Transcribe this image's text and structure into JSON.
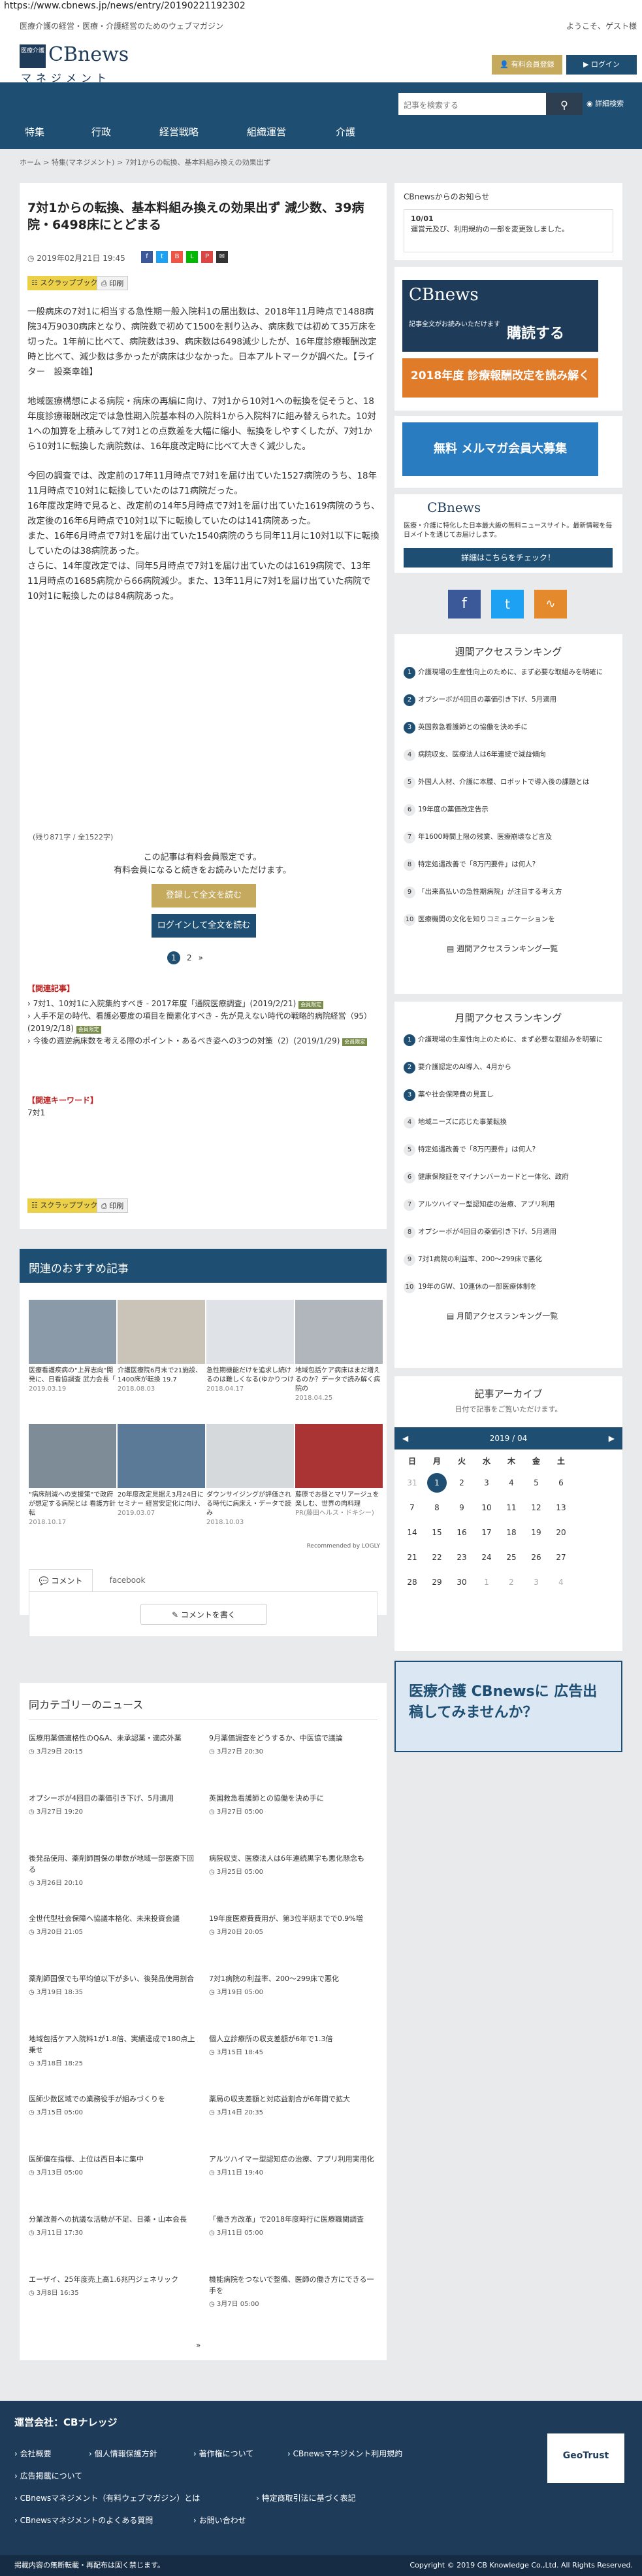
{
  "url": "https://www.cbnews.jp/news/entry/20190221192302",
  "top": {
    "tagline": "医療介護の経営・医療・介護経営のためのウェブマガジン",
    "welcome": "ようこそ、ゲスト様"
  },
  "logo": {
    "badge": "医療介護",
    "name": "CBnews",
    "sub": "マネジメント"
  },
  "header_buttons": {
    "register": "有料会員登録",
    "login": "ログイン"
  },
  "nav": {
    "items": [
      "特集",
      "行政",
      "経営戦略",
      "組織運営",
      "介護"
    ]
  },
  "search": {
    "placeholder": "記事を検索する",
    "detail": "詳細検索"
  },
  "breadcrumb": "ホーム > 特集(マネジメント) > 7対1からの転換、基本料組み換えの効果出ず",
  "article": {
    "title": "7対1からの転換、基本料組み換えの効果出ず 減少数、39病院・6498床にとどまる",
    "date": "2019年02月21日 19:45",
    "scrap": "スクラップブック",
    "print": "印刷",
    "paragraphs": [
      "一般病床の7対1に相当する急性期一般入院料1の届出数は、2018年11月時点で1488病院34万9030病床となり、病院数で初めて1500を割り込み、病床数では初めて35万床を切った。1年前に比べて、病院数は39、病床数は6498減少したが、16年度診療報酬改定時と比べて、減少数は多かったが病床は少なかった。日本アルトマークが調べた。【ライター　設楽幸雄】",
      "地域医療構想による病院・病床の再編に向け、7対1から10対1への転換を促そうと、18年度診療報酬改定では急性期入院基本料の入院料1から入院料7に組み替えられた。10対1への加算を上積みして7対1との点数差を大幅に縮小、転換をしやすくしたが、7対1から10対1に転換した病院数は、16年度改定時に比べて大きく減少した。",
      "今回の調査では、改定前の17年11月時点で7対1を届け出ていた1527病院のうち、18年11月時点で10対1に転換していたのは71病院だった。",
      "16年度改定時で見ると、改定前の14年5月時点で7対1を届け出ていた1619病院のうち、改定後の16年6月時点で10対1以下に転換していたのは141病院あった。",
      "また、16年6月時点で7対1を届け出ていた1540病院のうち同年11月に10対1以下に転換していたのは38病院あった。",
      "さらに、14年度改定では、同年5月時点で7対1を届け出ていたのは1619病院で、13年11月時点の1685病院から66病院減少。また、13年11月に7対1を届け出ていた病院で10対1に転換したのは84病院あった。"
    ],
    "charcount": "(残り871字 / 全1522字)",
    "members_only": [
      "この記事は有料会員限定です。",
      "有料会員になると続きをお読みいただけます。"
    ],
    "register_btn": "登録して全文を読む",
    "login_btn": "ログインして全文を読む",
    "pages": [
      "1",
      "2",
      "»"
    ]
  },
  "related": {
    "title": "【関連記事】",
    "items": [
      "7対1、10対1に入院集約すべき - 2017年度「通院医療調査」(2019/2/21)",
      "人手不足の時代、看護必要度の項目を簡素化すべき - 先が見えない時代の戦略的病院経営（95）(2019/2/18)",
      "今後の週逆病床数を考える際のポイント・あるべき姿への3つの対策（2）(2019/1/29)"
    ],
    "badge": "会員限定"
  },
  "keywords": {
    "title": "【関連キーワード】",
    "items": [
      "7対1"
    ]
  },
  "sidebar": {
    "notice_title": "CBnewsからのお知らせ",
    "notice_date": "10/01",
    "notice_text": "運営元及び、利用規約の一部を変更致しました。",
    "ad1_text": "記事全文がお読みいただけます",
    "ad1_cta": "購読する",
    "ad2_text": "2018年度 診療報酬改定を読み解く",
    "ad3_text": "無料 メルマガ会員大募集",
    "about_text": "医療・介護に特化した日本最大級の無料ニュースサイト。最新情報を毎日メイトを通じてお届けします。",
    "about_btn": "詳細はこちらをチェック！",
    "weekly_title": "週間アクセスランキング",
    "weekly": [
      "介護現場の生産性向上のために、まず必要な取組みを明確に",
      "オプシーボが4回目の薬価引き下げ、5月適用",
      "英国救急看護師との協働を決め手に",
      "病院収支、医療法人は6年連続で減益傾向",
      "外国人人材、介護に本腰、ロボットで導入後の課題とは",
      "19年度の薬価改定告示",
      "年1600時間上限の残業、医療崩壊など言及",
      "特定処遇改善で「8万円要件」は何人?",
      "「出来高払いの急性期病院」が注目する考え方",
      "医療機関の文化を知りコミュニケーションを"
    ],
    "weekly_more": "週間アクセスランキング一覧",
    "monthly_title": "月間アクセスランキング",
    "monthly": [
      "介護現場の生産性向上のために、まず必要な取組みを明確に",
      "要介護認定のAI導入、4月から",
      "薬や社会保障費の見直し",
      "地域ニーズに応じた事業転換",
      "特定処遇改善で「8万円要件」は何人?",
      "健康保険証をマイナンバーカードと一体化、政府",
      "アルツハイマー型認知症の治療、アプリ利用",
      "オプシーボが4回目の薬価引き下げ、5月適用",
      "7対1病院の利益率、200～299床で悪化",
      "19年のGW、10連休の一部医療体制を"
    ],
    "monthly_more": "月間アクセスランキング一覧",
    "archive_title": "記事アーカイブ",
    "archive_sub": "日付で記事をご覧いただけます。",
    "calendar_month": "2019 / 04",
    "weekdays": [
      "日",
      "月",
      "火",
      "水",
      "木",
      "金",
      "土"
    ],
    "weeks": [
      [
        "31",
        "1",
        "2",
        "3",
        "4",
        "5",
        "6"
      ],
      [
        "7",
        "8",
        "9",
        "10",
        "11",
        "12",
        "13"
      ],
      [
        "14",
        "15",
        "16",
        "17",
        "18",
        "19",
        "20"
      ],
      [
        "21",
        "22",
        "23",
        "24",
        "25",
        "26",
        "27"
      ],
      [
        "28",
        "29",
        "30",
        "1",
        "2",
        "3",
        "4"
      ]
    ],
    "ad_bottom": "医療介護 CBnewsに 広告出稿してみませんか？"
  },
  "reco": {
    "title": "関連のおすすめ記事",
    "row1": [
      {
        "t": "医療看護疾病の\"上昇志向\"開発に、日看協調査 武力会長「",
        "d": "2019.03.19"
      },
      {
        "t": "介護医療院6月末で21施設、1400床が転換 19.7",
        "d": "2018.08.03"
      },
      {
        "t": "急性期機能だけを追求し続けるのは難しくなる(ゆかりつけ",
        "d": "2018.04.17"
      },
      {
        "t": "地域包括ケア病床はまだ増えるのか？データで読み解く病院の",
        "d": "2018.04.25"
      }
    ],
    "row2": [
      {
        "t": "\"病床削減への支援策\"で政府が想定する病院とは 看護方針転",
        "d": "2018.10.17"
      },
      {
        "t": "20年度改定見据え3月24日にセミナー 経営安定化に向け、",
        "d": "2019.03.07"
      },
      {
        "t": "ダウンサイジングが評価される時代に病床え・データで読み",
        "d": "2018.10.03"
      },
      {
        "t": "藤原でお昼とマリアージュを楽しむ、世界の肉料理",
        "d": "PR(藤田ヘルス・ドキシー)"
      }
    ],
    "recommend_by": "Recommended by LOGLY"
  },
  "comments": {
    "tab1": "コメント",
    "tab2": "facebook",
    "write": "コメントを書く"
  },
  "catnews": {
    "title": "同カテゴリーのニュース",
    "left": [
      {
        "t": "医療用薬価適格性のQ&A、未承認薬・適応外薬",
        "d": "3月29日 20:15"
      },
      {
        "t": "オプシーボが4回目の薬価引き下げ、5月適用",
        "d": "3月27日 19:20"
      },
      {
        "t": "後発品使用、薬剤師国保の単数が地域一部医療下回る",
        "d": "3月26日 20:10"
      },
      {
        "t": "全世代型社会保障へ協議本格化、未来投資会議",
        "d": "3月20日 21:05"
      },
      {
        "t": "薬剤師国保でも平均値以下が多い、後発品使用割合",
        "d": "3月19日 18:35"
      },
      {
        "t": "地域包括ケア入院料1が1.8倍、実績達成で180点上乗せ",
        "d": "3月18日 18:25"
      },
      {
        "t": "医師少数区域での業務役手が組みづくりを",
        "d": "3月15日 05:00"
      },
      {
        "t": "医師偏在指標、上位は西日本に集中",
        "d": "3月13日 05:00"
      },
      {
        "t": "分業改善への抗議な活動が不足、日薬・山本会長",
        "d": "3月11日 17:30"
      },
      {
        "t": "エーザイ、25年度売上高1.6兆円ジェネリック",
        "d": "3月8日 16:35"
      }
    ],
    "right": [
      {
        "t": "9月薬価調査をどうするか、中医協で議論",
        "d": "3月27日 20:30"
      },
      {
        "t": "英国救急看護師との協働を決め手に",
        "d": "3月27日 05:00"
      },
      {
        "t": "病院収支、医療法人は6年連続黒字も悪化懸念も",
        "d": "3月25日 05:00"
      },
      {
        "t": "19年度医療費費用が、第3位半期までで0.9%増",
        "d": "3月20日 20:05"
      },
      {
        "t": "7対1病院の利益率、200～299床で悪化",
        "d": "3月19日 05:00"
      },
      {
        "t": "個人立診療所の収支差額が6年で1.3倍",
        "d": "3月15日 18:45"
      },
      {
        "t": "薬局の収支差額と対応益割合が6年間で拡大",
        "d": "3月14日 20:35"
      },
      {
        "t": "アルツハイマー型認知症の治療、アプリ利用実用化",
        "d": "3月11日 19:40"
      },
      {
        "t": "「働き方改革」で2018年度時行に医療職関調査",
        "d": "3月11日 05:00"
      },
      {
        "t": "機能病院をつないで整備、医師の働き方にできる一手を",
        "d": "3月7日 05:00"
      }
    ],
    "more": "»"
  },
  "footer": {
    "title": "運営会社：CBナレッジ",
    "links1": [
      "会社概要",
      "個人情報保護方針",
      "著作権について",
      "CBnewsマネジメント利用規約"
    ],
    "links2": [
      "広告掲載について"
    ],
    "links3": [
      "CBnewsマネジメント（有料ウェブマガジン）とは",
      "特定商取引法に基づく表記"
    ],
    "links4": [
      "CBnewsマネジメントのよくある質問",
      "お問い合わせ"
    ],
    "trust": "GeoTrust",
    "bottom_left": "掲載内容の無断転載・再配布は固く禁じます。",
    "copyright": "Copyright © 2019 CB Knowledge Co.,Ltd. All Rights Reserved."
  },
  "colors": {
    "navy": "#1e4e72",
    "gold": "#c5a95d",
    "red": "#c8283c",
    "orange": "#e07b2a"
  }
}
